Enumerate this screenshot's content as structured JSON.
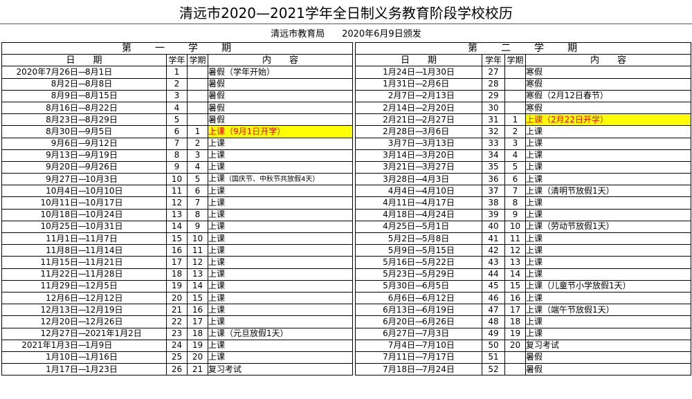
{
  "title": "清远市2020—2021学年全日制义务教育阶段学校校历",
  "issuer": "清远市教育局      2020年6月9日颁发",
  "headers": {
    "date": "日　　期",
    "week_year": "学年",
    "week_term": "学期",
    "content": "内　　容"
  },
  "highlight_colors": {
    "background": "#ffff00",
    "text": "#ff0000"
  },
  "semester1": {
    "title": "第　　一　　学　　期",
    "rows": [
      {
        "start": "2020年7月26日",
        "end": "8月1日",
        "wy": "1",
        "wt": "",
        "content": "暑假（学年开始）"
      },
      {
        "start": "8月2日",
        "end": "8月8日",
        "wy": "2",
        "wt": "",
        "content": "暑假"
      },
      {
        "start": "8月9日",
        "end": "8月15日",
        "wy": "3",
        "wt": "",
        "content": "暑假"
      },
      {
        "start": "8月16日",
        "end": "8月22日",
        "wy": "4",
        "wt": "",
        "content": "暑假"
      },
      {
        "start": "8月23日",
        "end": "8月29日",
        "wy": "5",
        "wt": "",
        "content": "暑假"
      },
      {
        "start": "8月30日",
        "end": "9月5日",
        "wy": "6",
        "wt": "1",
        "content": "上课（9月1日开学）",
        "hl": true
      },
      {
        "start": "9月6日",
        "end": "9月12日",
        "wy": "7",
        "wt": "2",
        "content": "上课"
      },
      {
        "start": "9月13日",
        "end": "9月19日",
        "wy": "8",
        "wt": "3",
        "content": "上课"
      },
      {
        "start": "9月20日",
        "end": "9月26日",
        "wy": "9",
        "wt": "4",
        "content": "上课"
      },
      {
        "start": "9月27日",
        "end": "10月3日",
        "wy": "10",
        "wt": "5",
        "content": "上课",
        "note": "（国庆节、中秋节共放假4天）"
      },
      {
        "start": "10月4日",
        "end": "10月10日",
        "wy": "11",
        "wt": "6",
        "content": "上课"
      },
      {
        "start": "10月11日",
        "end": "10月17日",
        "wy": "12",
        "wt": "7",
        "content": "上课"
      },
      {
        "start": "10月18日",
        "end": "10月24日",
        "wy": "13",
        "wt": "8",
        "content": "上课"
      },
      {
        "start": "10月25日",
        "end": "10月31日",
        "wy": "14",
        "wt": "9",
        "content": "上课"
      },
      {
        "start": "11月1日",
        "end": "11月7日",
        "wy": "15",
        "wt": "10",
        "content": "上课"
      },
      {
        "start": "11月8日",
        "end": "11月14日",
        "wy": "16",
        "wt": "11",
        "content": "上课"
      },
      {
        "start": "11月15日",
        "end": "11月21日",
        "wy": "17",
        "wt": "12",
        "content": "上课"
      },
      {
        "start": "11月22日",
        "end": "11月28日",
        "wy": "18",
        "wt": "13",
        "content": "上课"
      },
      {
        "start": "11月29日",
        "end": "12月5日",
        "wy": "19",
        "wt": "14",
        "content": "上课"
      },
      {
        "start": "12月6日",
        "end": "12月12日",
        "wy": "20",
        "wt": "15",
        "content": "上课"
      },
      {
        "start": "12月13日",
        "end": "12月19日",
        "wy": "21",
        "wt": "16",
        "content": "上课"
      },
      {
        "start": "12月20日",
        "end": "12月26日",
        "wy": "22",
        "wt": "17",
        "content": "上课"
      },
      {
        "start": "12月27日",
        "end": "2021年1月2日",
        "wy": "23",
        "wt": "18",
        "content": "上课（元旦放假1天）"
      },
      {
        "start": "2021年1月3日",
        "end": "1月9日",
        "wy": "24",
        "wt": "19",
        "content": "上课"
      },
      {
        "start": "1月10日",
        "end": "1月16日",
        "wy": "25",
        "wt": "20",
        "content": "上课"
      },
      {
        "start": "1月17日",
        "end": "1月23日",
        "wy": "26",
        "wt": "21",
        "content": "复习考试"
      }
    ]
  },
  "semester2": {
    "title": "第　　二　　学　　期",
    "rows": [
      {
        "start": "1月24日",
        "end": "1月30日",
        "wy": "27",
        "wt": "",
        "content": "寒假"
      },
      {
        "start": "1月31日",
        "end": "2月6日",
        "wy": "28",
        "wt": "",
        "content": "寒假"
      },
      {
        "start": "2月7日",
        "end": "2月13日",
        "wy": "29",
        "wt": "",
        "content": "寒假（2月12日春节）"
      },
      {
        "start": "2月14日",
        "end": "2月20日",
        "wy": "30",
        "wt": "",
        "content": "寒假"
      },
      {
        "start": "2月21日",
        "end": "2月27日",
        "wy": "31",
        "wt": "1",
        "content": "上课（2月22日开学）",
        "hl": true
      },
      {
        "start": "2月28日",
        "end": "3月6日",
        "wy": "32",
        "wt": "2",
        "content": "上课"
      },
      {
        "start": "3月7日",
        "end": "3月13日",
        "wy": "33",
        "wt": "3",
        "content": "上课"
      },
      {
        "start": "3月14日",
        "end": "3月20日",
        "wy": "34",
        "wt": "4",
        "content": "上课"
      },
      {
        "start": "3月21日",
        "end": "3月27日",
        "wy": "35",
        "wt": "5",
        "content": "上课"
      },
      {
        "start": "3月28日",
        "end": "4月3日",
        "wy": "36",
        "wt": "6",
        "content": "上课"
      },
      {
        "start": "4月4日",
        "end": "4月10日",
        "wy": "37",
        "wt": "7",
        "content": "上课（清明节放假1天）"
      },
      {
        "start": "4月11日",
        "end": "4月17日",
        "wy": "38",
        "wt": "8",
        "content": "上课"
      },
      {
        "start": "4月18日",
        "end": "4月24日",
        "wy": "39",
        "wt": "9",
        "content": "上课"
      },
      {
        "start": "4月25日",
        "end": "5月1日",
        "wy": "40",
        "wt": "10",
        "content": "上课（劳动节放假1天）"
      },
      {
        "start": "5月2日",
        "end": "5月8日",
        "wy": "41",
        "wt": "11",
        "content": "上课"
      },
      {
        "start": "5月9日",
        "end": "5月15日",
        "wy": "42",
        "wt": "12",
        "content": "上课"
      },
      {
        "start": "5月16日",
        "end": "5月22日",
        "wy": "43",
        "wt": "13",
        "content": "上课"
      },
      {
        "start": "5月23日",
        "end": "5月29日",
        "wy": "44",
        "wt": "14",
        "content": "上课"
      },
      {
        "start": "5月30日",
        "end": "6月5日",
        "wy": "45",
        "wt": "15",
        "content": "上课（儿童节小学放假1天）"
      },
      {
        "start": "6月6日",
        "end": "6月12日",
        "wy": "46",
        "wt": "16",
        "content": "上课"
      },
      {
        "start": "6月13日",
        "end": "6月19日",
        "wy": "47",
        "wt": "17",
        "content": "上课（端午节放假1天）"
      },
      {
        "start": "6月20日",
        "end": "6月26日",
        "wy": "48",
        "wt": "18",
        "content": "上课"
      },
      {
        "start": "6月27日",
        "end": "7月3日",
        "wy": "49",
        "wt": "19",
        "content": "上课"
      },
      {
        "start": "7月4日",
        "end": "7月10日",
        "wy": "50",
        "wt": "20",
        "content": "复习考试"
      },
      {
        "start": "7月11日",
        "end": "7月17日",
        "wy": "51",
        "wt": "",
        "content": "暑假"
      },
      {
        "start": "7月18日",
        "end": "7月24日",
        "wy": "52",
        "wt": "",
        "content": "暑假"
      }
    ]
  },
  "date_separator": "—"
}
